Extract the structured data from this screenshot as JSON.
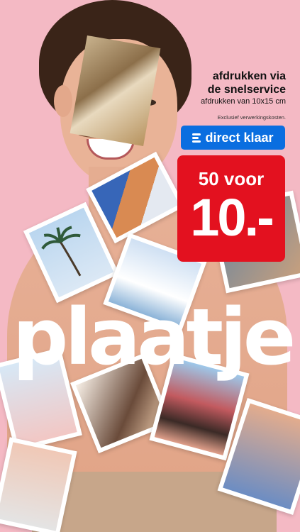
{
  "info": {
    "title_line1": "afdrukken via",
    "title_line2": "de snelservice",
    "subtitle": "afdrukken van 10x15 cm",
    "note": "Exclusief verwerkingskosten."
  },
  "cta": {
    "label": "direct klaar",
    "icon": "menu-lines-icon"
  },
  "price": {
    "top": "50 voor",
    "amount": "10.-"
  },
  "headline": "plaatje",
  "colors": {
    "background": "#f4b9c4",
    "cta": "#0a6ee0",
    "price": "#e3111f"
  }
}
